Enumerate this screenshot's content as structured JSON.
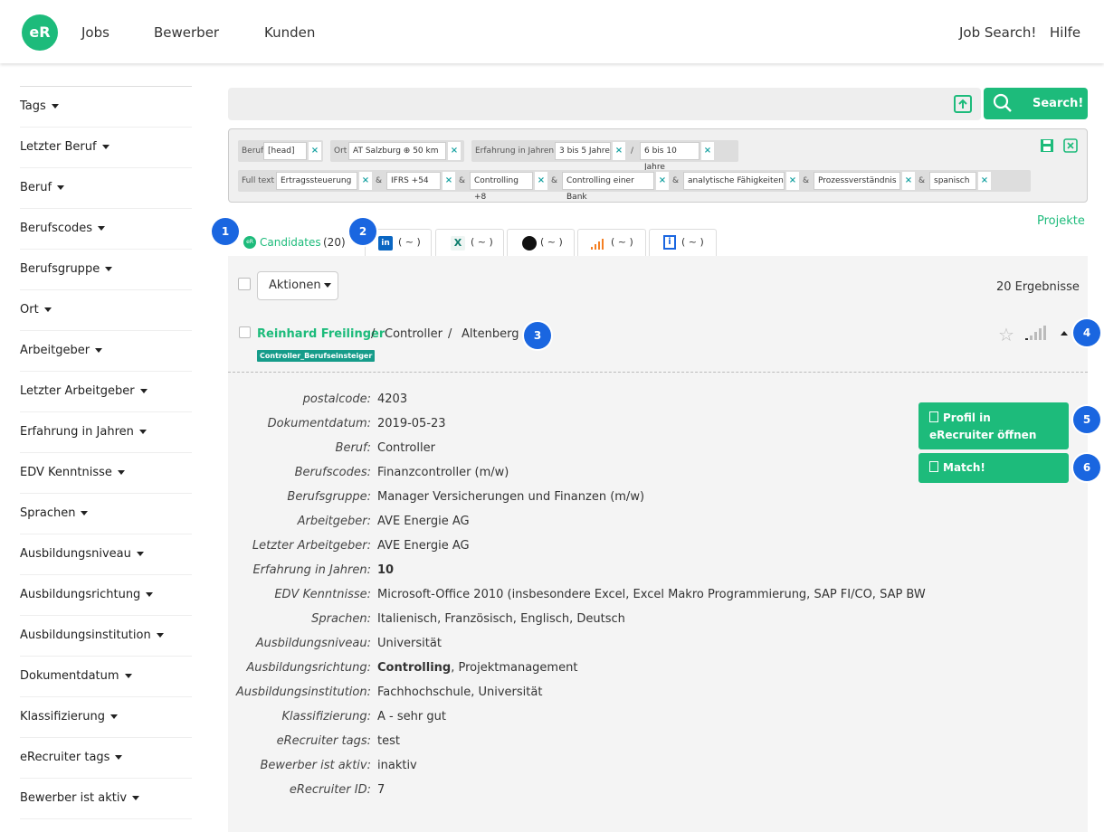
{
  "nav": {
    "logo": "eR",
    "links": [
      "Jobs",
      "Bewerber",
      "Kunden"
    ],
    "right_links": [
      "Job Search!",
      "Hilfe"
    ]
  },
  "sidebar": {
    "items": [
      {
        "label": "Tags"
      },
      {
        "label": "Letzter Beruf"
      },
      {
        "label": "Beruf"
      },
      {
        "label": "Berufscodes"
      },
      {
        "label": "Berufsgruppe"
      },
      {
        "label": "Ort"
      },
      {
        "label": "Arbeitgeber"
      },
      {
        "label": "Letzter Arbeitgeber"
      },
      {
        "label": "Erfahrung in Jahren"
      },
      {
        "label": "EDV Kenntnisse"
      },
      {
        "label": "Sprachen"
      },
      {
        "label": "Ausbildungsniveau"
      },
      {
        "label": "Ausbildungsrichtung"
      },
      {
        "label": "Ausbildungsinstitution"
      },
      {
        "label": "Dokumentdatum"
      },
      {
        "label": "Klassifizierung"
      },
      {
        "label": "eRecruiter tags"
      },
      {
        "label": "Bewerber ist aktiv"
      }
    ]
  },
  "search": {
    "button": "Search!",
    "value": ""
  },
  "filters": {
    "row1": {
      "beruf_label": "Beruf",
      "beruf_value": "[head]",
      "ort_label": "Ort",
      "ort_value": "AT Salzburg ⊕ 50 km",
      "erf_label": "Erfahrung in Jahren",
      "erf_v1": "3 bis 5 Jahre",
      "erf_sep": "/",
      "erf_v2": "6 bis 10 Jahre"
    },
    "row2": {
      "label": "Full text",
      "terms": [
        "Ertragssteuerung",
        "IFRS +54",
        "Controlling +8",
        "Controlling einer Bank",
        "analytische Fähigkeiten",
        "Prozessverständnis",
        "spanisch"
      ],
      "op": "&"
    }
  },
  "projekte_link": "Projekte",
  "tabs": {
    "candidates": "Candidates",
    "candidates_count": "(20)",
    "other_count": "( ~ )"
  },
  "badges": [
    "1",
    "2",
    "3",
    "4",
    "5",
    "6"
  ],
  "toolbar": {
    "actions": "Aktionen",
    "results": "20 Ergebnisse"
  },
  "candidate": {
    "name": "Reinhard Freilinger",
    "sep": "/",
    "role": "Controller",
    "city": "Altenberg",
    "tag": "Controller_Berufseinsteiger",
    "fields": [
      {
        "key": "postalcode:",
        "val": "4203"
      },
      {
        "key": "Dokumentdatum:",
        "val": "2019-05-23"
      },
      {
        "key": "Beruf:",
        "val": "Controller"
      },
      {
        "key": "Berufscodes:",
        "val": "Finanzcontroller (m/w)"
      },
      {
        "key": "Berufsgruppe:",
        "val": "Manager Versicherungen und Finanzen (m/w)"
      },
      {
        "key": "Arbeitgeber:",
        "val": "AVE Energie AG"
      },
      {
        "key": "Letzter Arbeitgeber:",
        "val": "AVE Energie AG"
      },
      {
        "key": "Erfahrung in Jahren:",
        "val": "10"
      },
      {
        "key": "EDV Kenntnisse:",
        "val": "Microsoft-Office 2010 (insbesondere Excel, Excel Makro Programmierung, SAP FI/CO, SAP BW"
      },
      {
        "key": "Sprachen:",
        "val": "Italienisch, Französisch, Englisch, Deutsch"
      },
      {
        "key": "Ausbildungsniveau:",
        "val": "Universität"
      },
      {
        "key": "Ausbildungsrichtung:",
        "val_bold": "Controlling",
        "val": ", Projektmanagement"
      },
      {
        "key": "Ausbildungsinstitution:",
        "val": "Fachhochschule, Universität"
      },
      {
        "key": "Klassifizierung:",
        "val": "A - sehr gut"
      },
      {
        "key": "eRecruiter tags:",
        "val": "test"
      },
      {
        "key": "Bewerber ist aktiv:",
        "val": "inaktiv"
      },
      {
        "key": "eRecruiter ID:",
        "val": "7"
      }
    ],
    "btn_profile": "Profil in eRecruiter öffnen",
    "btn_match": "Match!"
  },
  "colors": {
    "accent": "#1dbb7b",
    "badge": "#1a66e0",
    "tag": "#169c8a"
  }
}
